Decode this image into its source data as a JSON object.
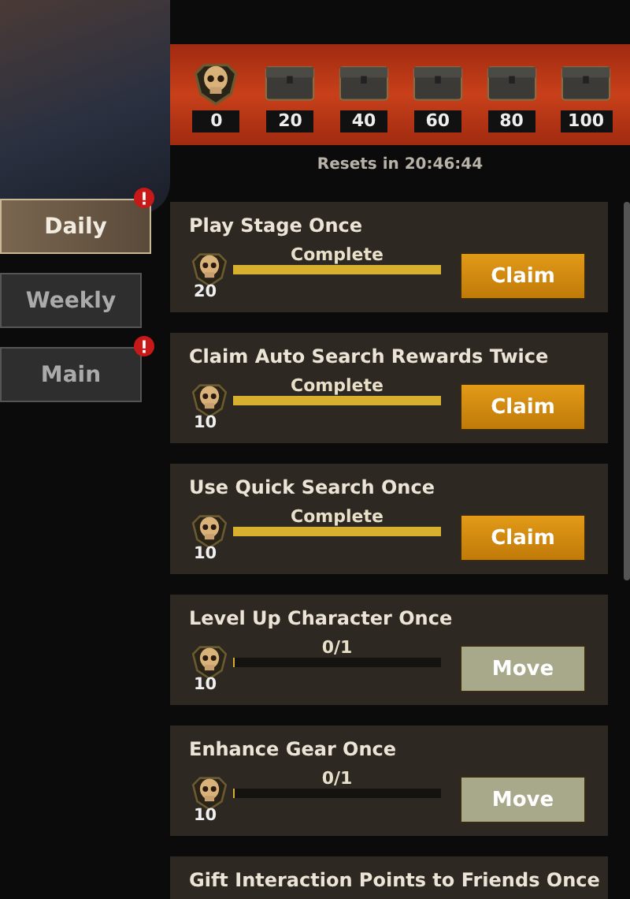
{
  "milestones": [
    {
      "kind": "skull",
      "value": "0"
    },
    {
      "kind": "chest",
      "value": "20"
    },
    {
      "kind": "chest",
      "value": "40"
    },
    {
      "kind": "chest",
      "value": "60"
    },
    {
      "kind": "chest",
      "value": "80"
    },
    {
      "kind": "chest",
      "value": "100"
    }
  ],
  "reset_text": "Resets in 20:46:44",
  "tabs": [
    {
      "label": "Daily",
      "selected": true,
      "alert": true
    },
    {
      "label": "Weekly",
      "selected": false,
      "alert": false
    },
    {
      "label": "Main",
      "selected": false,
      "alert": true
    }
  ],
  "tasks": [
    {
      "title": "Play Stage Once",
      "reward": "20",
      "level": 1,
      "progress": "Complete",
      "button": {
        "label": "Claim",
        "kind": "claim"
      }
    },
    {
      "title": "Claim Auto Search Rewards Twice",
      "reward": "10",
      "level": 1,
      "progress": "Complete",
      "button": {
        "label": "Claim",
        "kind": "claim"
      }
    },
    {
      "title": "Use Quick Search Once",
      "reward": "10",
      "level": 1,
      "progress": "Complete",
      "button": {
        "label": "Claim",
        "kind": "claim"
      }
    },
    {
      "title": "Level Up Character Once",
      "reward": "10",
      "level": 0,
      "progress": "0/1",
      "button": {
        "label": "Move",
        "kind": "move"
      }
    },
    {
      "title": "Enhance Gear Once",
      "reward": "10",
      "level": 0,
      "progress": "0/1",
      "button": {
        "label": "Move",
        "kind": "move"
      }
    },
    {
      "title": "Gift Interaction Points to Friends Once"
    }
  ]
}
